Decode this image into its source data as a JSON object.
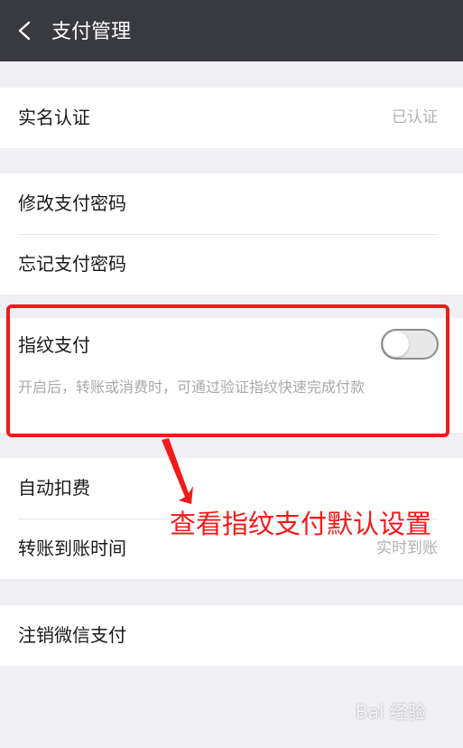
{
  "header": {
    "title": "支付管理"
  },
  "groups": [
    {
      "rows": [
        {
          "label": "实名认证",
          "value": "已认证"
        }
      ]
    },
    {
      "rows": [
        {
          "label": "修改支付密码"
        },
        {
          "label": "忘记支付密码"
        }
      ]
    },
    {
      "rows": [
        {
          "label": "指纹支付",
          "toggle": false,
          "desc": "开启后，转账或消费时，可通过验证指纹快速完成付款"
        }
      ]
    },
    {
      "rows": [
        {
          "label": "自动扣费"
        },
        {
          "label": "转账到账时间",
          "value": "实时到账"
        }
      ]
    },
    {
      "rows": [
        {
          "label": "注销微信支付"
        }
      ]
    }
  ],
  "annotation": {
    "text": "查看指纹支付默认设置",
    "color": "#f21a1a"
  },
  "watermark": {
    "text": "Bai 经验"
  },
  "colors": {
    "header_bg": "#393a3f",
    "page_bg": "#efeff4",
    "highlight": "#f21a1a"
  }
}
